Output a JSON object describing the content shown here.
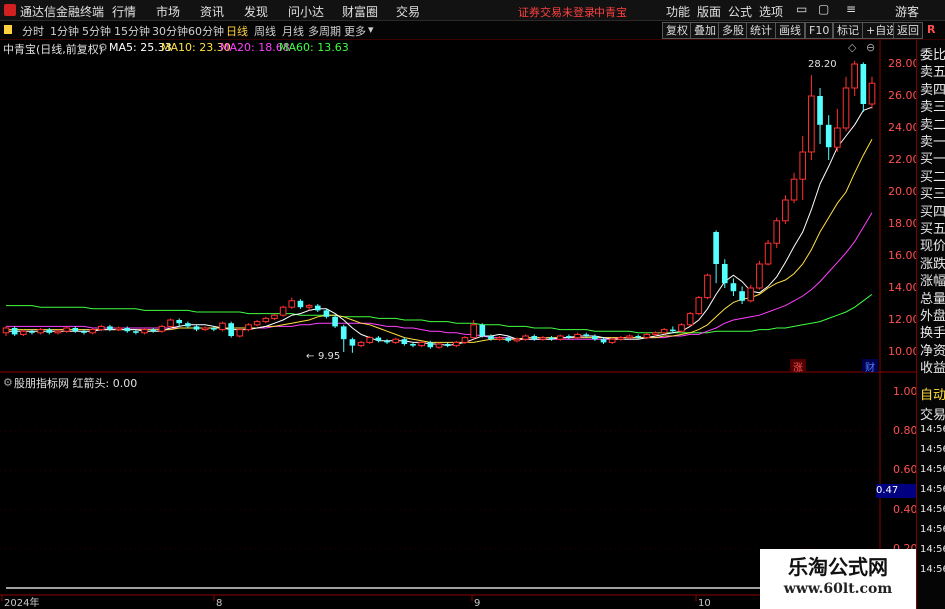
{
  "menu": {
    "app_title": "通达信金融终端",
    "items": [
      "行情",
      "市场",
      "资讯",
      "发现",
      "问小达",
      "财富圈",
      "交易"
    ],
    "notice": "证券交易未登录",
    "notice_stock": "中青宝",
    "right_items": [
      "功能",
      "版面",
      "公式",
      "选项"
    ],
    "guest": "游客"
  },
  "periods": {
    "items": [
      "分时",
      "1分钟",
      "5分钟",
      "15分钟",
      "30分钟",
      "60分钟",
      "日线",
      "周线",
      "月线",
      "多周期",
      "更多"
    ],
    "active": "日线",
    "tools": [
      "复权",
      "叠加",
      "多股",
      "统计",
      "画线",
      "F10",
      "标记",
      "+自选",
      "返回"
    ]
  },
  "main_chart": {
    "title": "中青宝(日线,前复权)",
    "ma": [
      {
        "label": "MA5: 25.33",
        "color": "#ffffff"
      },
      {
        "label": "MA10: 23.30",
        "color": "#ffe040"
      },
      {
        "label": "MA20: 18.68",
        "color": "#ff40ff"
      },
      {
        "label": "MA60: 13.63",
        "color": "#40ff40"
      }
    ],
    "high_label": "28.20",
    "low_label": "9.95",
    "y_ticks": [
      "28.00",
      "26.00",
      "24.00",
      "22.00",
      "20.00",
      "18.00",
      "16.00",
      "14.00",
      "12.00",
      "10.00"
    ],
    "x_labels": [
      "2024年",
      "8",
      "9",
      "10"
    ],
    "badge_zhang": "涨",
    "badge_cai": "财"
  },
  "sub_chart": {
    "title": "股朋指标网 红箭头: 0.00",
    "y_ticks": [
      "1.00",
      "0.80",
      "0.60",
      "0.40",
      "0.20"
    ],
    "current": "0.47"
  },
  "side_panel": {
    "top": [
      "委比",
      "卖五",
      "卖四",
      "卖三",
      "卖二",
      "卖一",
      "买一",
      "买二",
      "买三",
      "买四",
      "买五",
      "现价",
      "涨跌",
      "涨幅",
      "总量",
      "外盘",
      "换手",
      "净资",
      "收益"
    ],
    "bottom": [
      "自动",
      "交易",
      "14:56",
      "14:56",
      "14:56",
      "14:56",
      "14:56",
      "14:56",
      "14:56",
      "14:56"
    ]
  },
  "chart_data": {
    "type": "candlestick",
    "title": "中青宝(日线,前复权)",
    "ylim": [
      9.5,
      29
    ],
    "candles": [
      [
        11.2,
        11.5,
        11.0,
        11.6
      ],
      [
        11.5,
        11.1,
        11.0,
        11.6
      ],
      [
        11.1,
        11.3,
        11.0,
        11.4
      ],
      [
        11.3,
        11.2,
        11.1,
        11.4
      ],
      [
        11.2,
        11.4,
        11.1,
        11.5
      ],
      [
        11.4,
        11.2,
        11.1,
        11.5
      ],
      [
        11.2,
        11.3,
        11.1,
        11.4
      ],
      [
        11.3,
        11.5,
        11.2,
        11.6
      ],
      [
        11.5,
        11.3,
        11.2,
        11.6
      ],
      [
        11.3,
        11.2,
        11.1,
        11.4
      ],
      [
        11.2,
        11.4,
        11.1,
        11.5
      ],
      [
        11.4,
        11.6,
        11.3,
        11.7
      ],
      [
        11.6,
        11.4,
        11.3,
        11.7
      ],
      [
        11.4,
        11.5,
        11.3,
        11.6
      ],
      [
        11.5,
        11.3,
        11.2,
        11.6
      ],
      [
        11.3,
        11.2,
        11.1,
        11.4
      ],
      [
        11.2,
        11.4,
        11.1,
        11.5
      ],
      [
        11.4,
        11.3,
        11.2,
        11.5
      ],
      [
        11.3,
        11.6,
        11.2,
        11.7
      ],
      [
        11.6,
        12.0,
        11.5,
        12.1
      ],
      [
        12.0,
        11.8,
        11.6,
        12.1
      ],
      [
        11.8,
        11.6,
        11.5,
        11.9
      ],
      [
        11.6,
        11.4,
        11.3,
        11.7
      ],
      [
        11.4,
        11.5,
        11.3,
        11.6
      ],
      [
        11.5,
        11.4,
        11.3,
        11.6
      ],
      [
        11.4,
        11.8,
        11.3,
        11.9
      ],
      [
        11.8,
        11.0,
        10.9,
        11.9
      ],
      [
        11.0,
        11.4,
        10.9,
        11.5
      ],
      [
        11.4,
        11.7,
        11.3,
        11.8
      ],
      [
        11.7,
        11.9,
        11.6,
        12.0
      ],
      [
        11.9,
        12.1,
        11.8,
        12.2
      ],
      [
        12.1,
        12.3,
        12.0,
        12.4
      ],
      [
        12.3,
        12.8,
        12.2,
        12.9
      ],
      [
        12.8,
        13.2,
        12.7,
        13.4
      ],
      [
        13.2,
        12.8,
        12.7,
        13.3
      ],
      [
        12.8,
        12.9,
        12.6,
        13.0
      ],
      [
        12.9,
        12.6,
        12.5,
        13.0
      ],
      [
        12.6,
        12.2,
        12.1,
        12.7
      ],
      [
        12.2,
        11.6,
        11.5,
        12.3
      ],
      [
        11.6,
        10.8,
        10.0,
        11.7
      ],
      [
        10.8,
        10.4,
        9.95,
        10.9
      ],
      [
        10.4,
        10.6,
        10.3,
        10.7
      ],
      [
        10.6,
        10.9,
        10.5,
        11.0
      ],
      [
        10.9,
        10.7,
        10.6,
        11.0
      ],
      [
        10.7,
        10.6,
        10.5,
        10.8
      ],
      [
        10.6,
        10.8,
        10.5,
        10.9
      ],
      [
        10.8,
        10.5,
        10.4,
        10.9
      ],
      [
        10.5,
        10.4,
        10.3,
        10.6
      ],
      [
        10.4,
        10.6,
        10.3,
        10.7
      ],
      [
        10.6,
        10.3,
        10.2,
        10.7
      ],
      [
        10.3,
        10.5,
        10.2,
        10.6
      ],
      [
        10.5,
        10.4,
        10.3,
        10.6
      ],
      [
        10.4,
        10.6,
        10.3,
        10.7
      ],
      [
        10.6,
        10.9,
        10.5,
        11.0
      ],
      [
        10.9,
        11.7,
        10.8,
        12.0
      ],
      [
        11.7,
        11.0,
        10.9,
        11.8
      ],
      [
        11.0,
        10.8,
        10.7,
        11.1
      ],
      [
        10.8,
        10.9,
        10.7,
        11.0
      ],
      [
        10.9,
        10.7,
        10.6,
        11.0
      ],
      [
        10.7,
        10.8,
        10.6,
        10.9
      ],
      [
        10.8,
        11.0,
        10.7,
        11.1
      ],
      [
        11.0,
        10.8,
        10.7,
        11.1
      ],
      [
        10.8,
        10.9,
        10.7,
        11.0
      ],
      [
        10.9,
        10.8,
        10.7,
        11.0
      ],
      [
        10.8,
        11.0,
        10.7,
        11.1
      ],
      [
        11.0,
        10.9,
        10.8,
        11.1
      ],
      [
        10.9,
        11.1,
        10.8,
        11.2
      ],
      [
        11.1,
        11.0,
        10.9,
        11.2
      ],
      [
        11.0,
        10.8,
        10.7,
        11.1
      ],
      [
        10.8,
        10.6,
        10.5,
        10.9
      ],
      [
        10.6,
        10.8,
        10.5,
        10.9
      ],
      [
        10.8,
        10.9,
        10.7,
        11.0
      ],
      [
        10.9,
        11.0,
        10.8,
        11.1
      ],
      [
        11.0,
        10.9,
        10.8,
        11.1
      ],
      [
        10.9,
        11.1,
        10.8,
        11.2
      ],
      [
        11.1,
        11.2,
        11.0,
        11.3
      ],
      [
        11.2,
        11.4,
        11.1,
        11.5
      ],
      [
        11.4,
        11.3,
        11.2,
        11.6
      ],
      [
        11.3,
        11.7,
        11.2,
        11.8
      ],
      [
        11.7,
        12.4,
        11.6,
        12.5
      ],
      [
        12.4,
        13.4,
        12.3,
        13.5
      ],
      [
        13.4,
        14.8,
        13.3,
        14.9
      ],
      [
        17.5,
        15.5,
        14.3,
        17.6
      ],
      [
        15.5,
        14.3,
        14.0,
        15.8
      ],
      [
        14.3,
        13.8,
        13.5,
        14.6
      ],
      [
        13.8,
        13.2,
        13.0,
        14.1
      ],
      [
        13.2,
        14.0,
        13.1,
        14.2
      ],
      [
        14.0,
        15.5,
        13.9,
        15.7
      ],
      [
        15.5,
        16.8,
        15.4,
        17.0
      ],
      [
        16.8,
        18.2,
        16.5,
        18.4
      ],
      [
        18.2,
        19.5,
        18.0,
        19.8
      ],
      [
        19.5,
        20.8,
        19.3,
        21.2
      ],
      [
        20.8,
        22.5,
        19.5,
        23.5
      ],
      [
        22.5,
        26.0,
        22.0,
        27.3
      ],
      [
        26.0,
        24.2,
        23.0,
        26.5
      ],
      [
        24.2,
        22.8,
        22.0,
        24.8
      ],
      [
        22.8,
        24.0,
        22.5,
        25.2
      ],
      [
        24.0,
        26.5,
        23.8,
        27.2
      ],
      [
        26.5,
        28.0,
        26.0,
        28.2
      ],
      [
        28.0,
        25.5,
        25.0,
        28.1
      ],
      [
        25.5,
        26.8,
        25.2,
        27.2
      ]
    ],
    "ma5": [
      11.3,
      11.3,
      11.3,
      11.3,
      11.3,
      11.3,
      11.3,
      11.3,
      11.3,
      11.3,
      11.3,
      11.4,
      11.4,
      11.4,
      11.4,
      11.4,
      11.3,
      11.3,
      11.3,
      11.5,
      11.6,
      11.7,
      11.7,
      11.7,
      11.6,
      11.5,
      11.4,
      11.4,
      11.4,
      11.5,
      11.6,
      11.8,
      12.0,
      12.3,
      12.4,
      12.6,
      12.7,
      12.7,
      12.4,
      12.0,
      11.5,
      11.1,
      10.9,
      10.7,
      10.7,
      10.7,
      10.7,
      10.6,
      10.6,
      10.5,
      10.5,
      10.4,
      10.5,
      10.6,
      10.8,
      11.0,
      11.0,
      11.1,
      11.0,
      10.8,
      10.8,
      10.8,
      10.8,
      10.8,
      10.9,
      10.9,
      11.0,
      11.0,
      11.0,
      10.9,
      10.8,
      10.8,
      10.8,
      10.8,
      10.9,
      11.0,
      11.1,
      11.2,
      11.3,
      11.6,
      12.0,
      12.7,
      13.6,
      14.4,
      14.8,
      14.4,
      13.8,
      13.7,
      14.1,
      14.7,
      15.6,
      16.6,
      17.5,
      18.9,
      20.5,
      21.6,
      22.8,
      23.5,
      24.2,
      25.1,
      25.3
    ],
    "ma10": [
      11.4,
      11.4,
      11.4,
      11.4,
      11.4,
      11.4,
      11.4,
      11.4,
      11.4,
      11.4,
      11.4,
      11.4,
      11.4,
      11.4,
      11.4,
      11.4,
      11.4,
      11.4,
      11.4,
      11.4,
      11.5,
      11.5,
      11.5,
      11.5,
      11.5,
      11.5,
      11.5,
      11.5,
      11.5,
      11.5,
      11.6,
      11.6,
      11.7,
      11.8,
      11.9,
      12.0,
      12.2,
      12.3,
      12.3,
      12.2,
      12.0,
      11.8,
      11.7,
      11.5,
      11.3,
      11.1,
      10.9,
      10.8,
      10.7,
      10.6,
      10.6,
      10.6,
      10.6,
      10.6,
      10.6,
      10.7,
      10.8,
      10.8,
      10.8,
      10.8,
      10.9,
      10.9,
      10.9,
      10.9,
      10.9,
      10.9,
      10.9,
      10.9,
      10.9,
      10.9,
      10.9,
      10.9,
      10.9,
      10.9,
      10.9,
      10.9,
      11.0,
      11.0,
      11.1,
      11.2,
      11.4,
      11.7,
      12.2,
      12.7,
      13.1,
      13.3,
      13.4,
      13.6,
      14.0,
      14.3,
      14.5,
      14.9,
      15.5,
      16.4,
      17.5,
      18.4,
      19.3,
      20.0,
      21.2,
      22.3,
      23.3
    ],
    "ma20": [
      11.6,
      11.6,
      11.6,
      11.6,
      11.6,
      11.6,
      11.6,
      11.6,
      11.6,
      11.6,
      11.5,
      11.5,
      11.5,
      11.5,
      11.5,
      11.5,
      11.5,
      11.5,
      11.5,
      11.5,
      11.5,
      11.5,
      11.5,
      11.5,
      11.5,
      11.5,
      11.5,
      11.5,
      11.5,
      11.5,
      11.5,
      11.6,
      11.6,
      11.6,
      11.7,
      11.7,
      11.8,
      11.8,
      11.8,
      11.8,
      11.8,
      11.8,
      11.8,
      11.7,
      11.6,
      11.6,
      11.5,
      11.5,
      11.4,
      11.3,
      11.3,
      11.2,
      11.2,
      11.1,
      11.1,
      11.0,
      10.9,
      10.9,
      10.9,
      10.8,
      10.8,
      10.8,
      10.8,
      10.8,
      10.8,
      10.8,
      10.8,
      10.8,
      10.8,
      10.8,
      10.8,
      10.9,
      10.9,
      10.9,
      10.9,
      10.9,
      10.9,
      11.0,
      11.0,
      11.1,
      11.1,
      11.3,
      11.5,
      11.8,
      12.0,
      12.1,
      12.2,
      12.3,
      12.5,
      12.7,
      12.9,
      13.2,
      13.5,
      13.9,
      14.4,
      15.0,
      15.6,
      16.2,
      16.9,
      17.8,
      18.7
    ],
    "ma60": [
      12.9,
      12.9,
      12.9,
      12.9,
      12.8,
      12.8,
      12.8,
      12.8,
      12.8,
      12.8,
      12.7,
      12.7,
      12.7,
      12.7,
      12.7,
      12.7,
      12.6,
      12.6,
      12.6,
      12.6,
      12.6,
      12.6,
      12.5,
      12.5,
      12.5,
      12.5,
      12.5,
      12.5,
      12.4,
      12.4,
      12.4,
      12.4,
      12.4,
      12.4,
      12.3,
      12.3,
      12.3,
      12.3,
      12.3,
      12.2,
      12.2,
      12.2,
      12.2,
      12.1,
      12.1,
      12.1,
      12.0,
      12.0,
      12.0,
      11.9,
      11.9,
      11.9,
      11.8,
      11.8,
      11.8,
      11.7,
      11.7,
      11.7,
      11.6,
      11.6,
      11.6,
      11.5,
      11.5,
      11.5,
      11.4,
      11.4,
      11.4,
      11.4,
      11.3,
      11.3,
      11.3,
      11.3,
      11.3,
      11.2,
      11.2,
      11.2,
      11.2,
      11.2,
      11.2,
      11.2,
      11.2,
      11.2,
      11.3,
      11.3,
      11.3,
      11.3,
      11.3,
      11.4,
      11.4,
      11.5,
      11.5,
      11.6,
      11.7,
      11.8,
      11.9,
      12.1,
      12.3,
      12.5,
      12.8,
      13.2,
      13.6
    ],
    "indicator": {
      "name": "红箭头",
      "value": 0.0,
      "ylim": [
        0,
        1
      ],
      "spikes": [
        0,
        0,
        0,
        0,
        0,
        0,
        0,
        0,
        0,
        0,
        0,
        0,
        0,
        0,
        0,
        0,
        0,
        0,
        0,
        0,
        0,
        0,
        0,
        0,
        0,
        0,
        0,
        0,
        0,
        0,
        0,
        0,
        0,
        0,
        0,
        0,
        0,
        0,
        0,
        0,
        0,
        0,
        0,
        0,
        0,
        0,
        0,
        0,
        0,
        0,
        0,
        0,
        0,
        0,
        0,
        0,
        0,
        0,
        0,
        0,
        0,
        0,
        0,
        0,
        0,
        0,
        0,
        0,
        0,
        0,
        0,
        0,
        0,
        0,
        0,
        0,
        0,
        0,
        0,
        0,
        0,
        0,
        0,
        0,
        0,
        0,
        0,
        0,
        0,
        0,
        0,
        0,
        0,
        0,
        0,
        0,
        0,
        0,
        0,
        0,
        0
      ]
    }
  }
}
